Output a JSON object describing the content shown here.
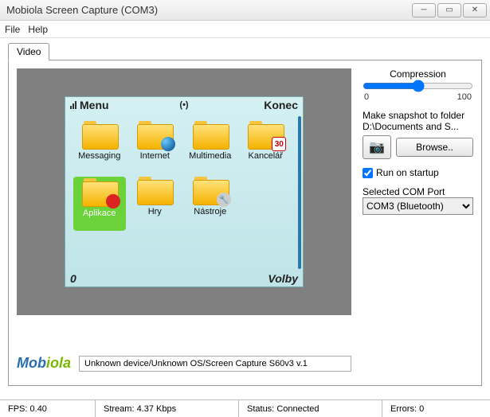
{
  "window": {
    "title": "Mobiola Screen Capture (COM3)"
  },
  "menu": {
    "file": "File",
    "help": "Help"
  },
  "tab": {
    "video": "Video"
  },
  "phone": {
    "menu_label": "Menu",
    "right_soft": "Konec",
    "center_indicator": "(•)",
    "bottom_left": "0",
    "bottom_right": "Volby",
    "icons": [
      {
        "label": "Messaging",
        "badge": ""
      },
      {
        "label": "Internet",
        "badge": "globe"
      },
      {
        "label": "Multimedia",
        "badge": ""
      },
      {
        "label": "Kancelář",
        "badge": "cal",
        "badge_text": "30"
      },
      {
        "label": "Aplikace",
        "badge": "red",
        "selected": true
      },
      {
        "label": "Hry",
        "badge": ""
      },
      {
        "label": "Nástroje",
        "badge": "wrench"
      }
    ]
  },
  "side": {
    "compression_label": "Compression",
    "comp_min": "0",
    "comp_max": "100",
    "snapshot_label": "Make snapshot to folder",
    "snapshot_path": "D:\\Documents and S...",
    "browse": "Browse..",
    "run_on_startup": "Run on startup",
    "run_checked": true,
    "com_label": "Selected COM Port",
    "com_value": "COM3 (Bluetooth)"
  },
  "logo": {
    "part1": "Mob",
    "part2": "iola"
  },
  "device_info": "Unknown device/Unknown OS/Screen Capture S60v3 v.1",
  "status": {
    "fps_label": "FPS:",
    "fps": "0.40",
    "stream_label": "Stream:",
    "stream": "4.37 Kbps",
    "status_label": "Status:",
    "status": "Connected",
    "errors_label": "Errors:",
    "errors": "0"
  }
}
